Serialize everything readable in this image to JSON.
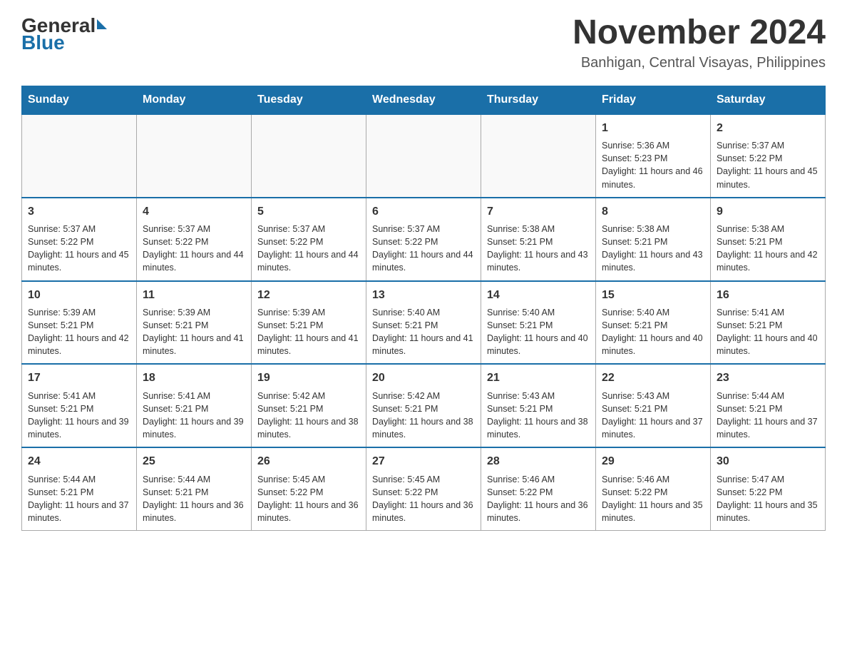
{
  "header": {
    "logo_general": "General",
    "logo_blue": "Blue",
    "main_title": "November 2024",
    "subtitle": "Banhigan, Central Visayas, Philippines"
  },
  "calendar": {
    "headers": [
      "Sunday",
      "Monday",
      "Tuesday",
      "Wednesday",
      "Thursday",
      "Friday",
      "Saturday"
    ],
    "weeks": [
      [
        {
          "day": "",
          "info": ""
        },
        {
          "day": "",
          "info": ""
        },
        {
          "day": "",
          "info": ""
        },
        {
          "day": "",
          "info": ""
        },
        {
          "day": "",
          "info": ""
        },
        {
          "day": "1",
          "info": "Sunrise: 5:36 AM\nSunset: 5:23 PM\nDaylight: 11 hours and 46 minutes."
        },
        {
          "day": "2",
          "info": "Sunrise: 5:37 AM\nSunset: 5:22 PM\nDaylight: 11 hours and 45 minutes."
        }
      ],
      [
        {
          "day": "3",
          "info": "Sunrise: 5:37 AM\nSunset: 5:22 PM\nDaylight: 11 hours and 45 minutes."
        },
        {
          "day": "4",
          "info": "Sunrise: 5:37 AM\nSunset: 5:22 PM\nDaylight: 11 hours and 44 minutes."
        },
        {
          "day": "5",
          "info": "Sunrise: 5:37 AM\nSunset: 5:22 PM\nDaylight: 11 hours and 44 minutes."
        },
        {
          "day": "6",
          "info": "Sunrise: 5:37 AM\nSunset: 5:22 PM\nDaylight: 11 hours and 44 minutes."
        },
        {
          "day": "7",
          "info": "Sunrise: 5:38 AM\nSunset: 5:21 PM\nDaylight: 11 hours and 43 minutes."
        },
        {
          "day": "8",
          "info": "Sunrise: 5:38 AM\nSunset: 5:21 PM\nDaylight: 11 hours and 43 minutes."
        },
        {
          "day": "9",
          "info": "Sunrise: 5:38 AM\nSunset: 5:21 PM\nDaylight: 11 hours and 42 minutes."
        }
      ],
      [
        {
          "day": "10",
          "info": "Sunrise: 5:39 AM\nSunset: 5:21 PM\nDaylight: 11 hours and 42 minutes."
        },
        {
          "day": "11",
          "info": "Sunrise: 5:39 AM\nSunset: 5:21 PM\nDaylight: 11 hours and 41 minutes."
        },
        {
          "day": "12",
          "info": "Sunrise: 5:39 AM\nSunset: 5:21 PM\nDaylight: 11 hours and 41 minutes."
        },
        {
          "day": "13",
          "info": "Sunrise: 5:40 AM\nSunset: 5:21 PM\nDaylight: 11 hours and 41 minutes."
        },
        {
          "day": "14",
          "info": "Sunrise: 5:40 AM\nSunset: 5:21 PM\nDaylight: 11 hours and 40 minutes."
        },
        {
          "day": "15",
          "info": "Sunrise: 5:40 AM\nSunset: 5:21 PM\nDaylight: 11 hours and 40 minutes."
        },
        {
          "day": "16",
          "info": "Sunrise: 5:41 AM\nSunset: 5:21 PM\nDaylight: 11 hours and 40 minutes."
        }
      ],
      [
        {
          "day": "17",
          "info": "Sunrise: 5:41 AM\nSunset: 5:21 PM\nDaylight: 11 hours and 39 minutes."
        },
        {
          "day": "18",
          "info": "Sunrise: 5:41 AM\nSunset: 5:21 PM\nDaylight: 11 hours and 39 minutes."
        },
        {
          "day": "19",
          "info": "Sunrise: 5:42 AM\nSunset: 5:21 PM\nDaylight: 11 hours and 38 minutes."
        },
        {
          "day": "20",
          "info": "Sunrise: 5:42 AM\nSunset: 5:21 PM\nDaylight: 11 hours and 38 minutes."
        },
        {
          "day": "21",
          "info": "Sunrise: 5:43 AM\nSunset: 5:21 PM\nDaylight: 11 hours and 38 minutes."
        },
        {
          "day": "22",
          "info": "Sunrise: 5:43 AM\nSunset: 5:21 PM\nDaylight: 11 hours and 37 minutes."
        },
        {
          "day": "23",
          "info": "Sunrise: 5:44 AM\nSunset: 5:21 PM\nDaylight: 11 hours and 37 minutes."
        }
      ],
      [
        {
          "day": "24",
          "info": "Sunrise: 5:44 AM\nSunset: 5:21 PM\nDaylight: 11 hours and 37 minutes."
        },
        {
          "day": "25",
          "info": "Sunrise: 5:44 AM\nSunset: 5:21 PM\nDaylight: 11 hours and 36 minutes."
        },
        {
          "day": "26",
          "info": "Sunrise: 5:45 AM\nSunset: 5:22 PM\nDaylight: 11 hours and 36 minutes."
        },
        {
          "day": "27",
          "info": "Sunrise: 5:45 AM\nSunset: 5:22 PM\nDaylight: 11 hours and 36 minutes."
        },
        {
          "day": "28",
          "info": "Sunrise: 5:46 AM\nSunset: 5:22 PM\nDaylight: 11 hours and 36 minutes."
        },
        {
          "day": "29",
          "info": "Sunrise: 5:46 AM\nSunset: 5:22 PM\nDaylight: 11 hours and 35 minutes."
        },
        {
          "day": "30",
          "info": "Sunrise: 5:47 AM\nSunset: 5:22 PM\nDaylight: 11 hours and 35 minutes."
        }
      ]
    ]
  }
}
